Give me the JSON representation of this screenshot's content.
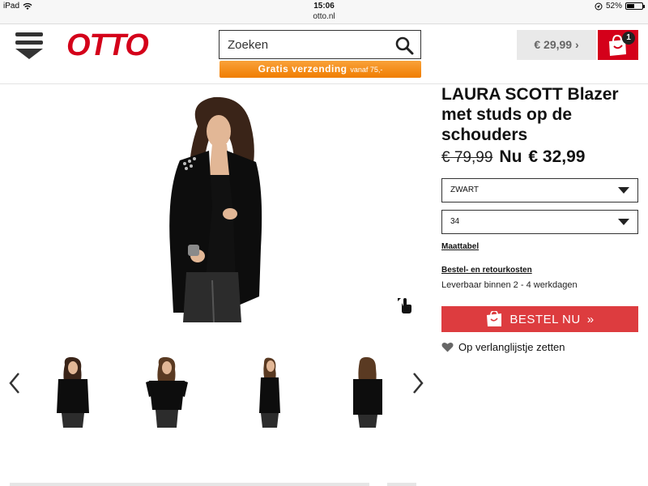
{
  "status_bar": {
    "device": "iPad",
    "time": "15:06",
    "url": "otto.nl",
    "battery": "52%",
    "battery_level": 0.52
  },
  "header": {
    "logo": "OTTO",
    "search_placeholder": "Zoeken",
    "promo_main": "Gratis verzending",
    "promo_small": "vanaf 75,-",
    "cart_total": "€ 29,99",
    "cart_count": "1"
  },
  "product": {
    "title": "LAURA SCOTT Blazer met studs op de schouders",
    "old_price": "€ 79,99",
    "now_label": "Nu",
    "price": "€ 32,99",
    "color_value": "ZWART",
    "size_value": "34",
    "size_chart_link": "Maattabel",
    "shipping_link": "Bestel- en retourkosten",
    "delivery_text": "Leverbaar binnen 2 - 4 werkdagen",
    "order_button": "BESTEL NU",
    "wishlist_text": "Op verlanglijstje zetten"
  },
  "colors": {
    "brand_red": "#d4001a",
    "order_button": "#dd3c3f",
    "promo_orange": "#f07d00",
    "cart_total_bg": "#e9e9e9"
  },
  "icons": [
    "wifi-icon",
    "location-icon",
    "menu-icon",
    "search-icon",
    "cart-bag-icon",
    "zoom-icon",
    "chevron-left-icon",
    "chevron-right-icon",
    "bag-icon",
    "double-chevron-icon",
    "heart-icon"
  ]
}
